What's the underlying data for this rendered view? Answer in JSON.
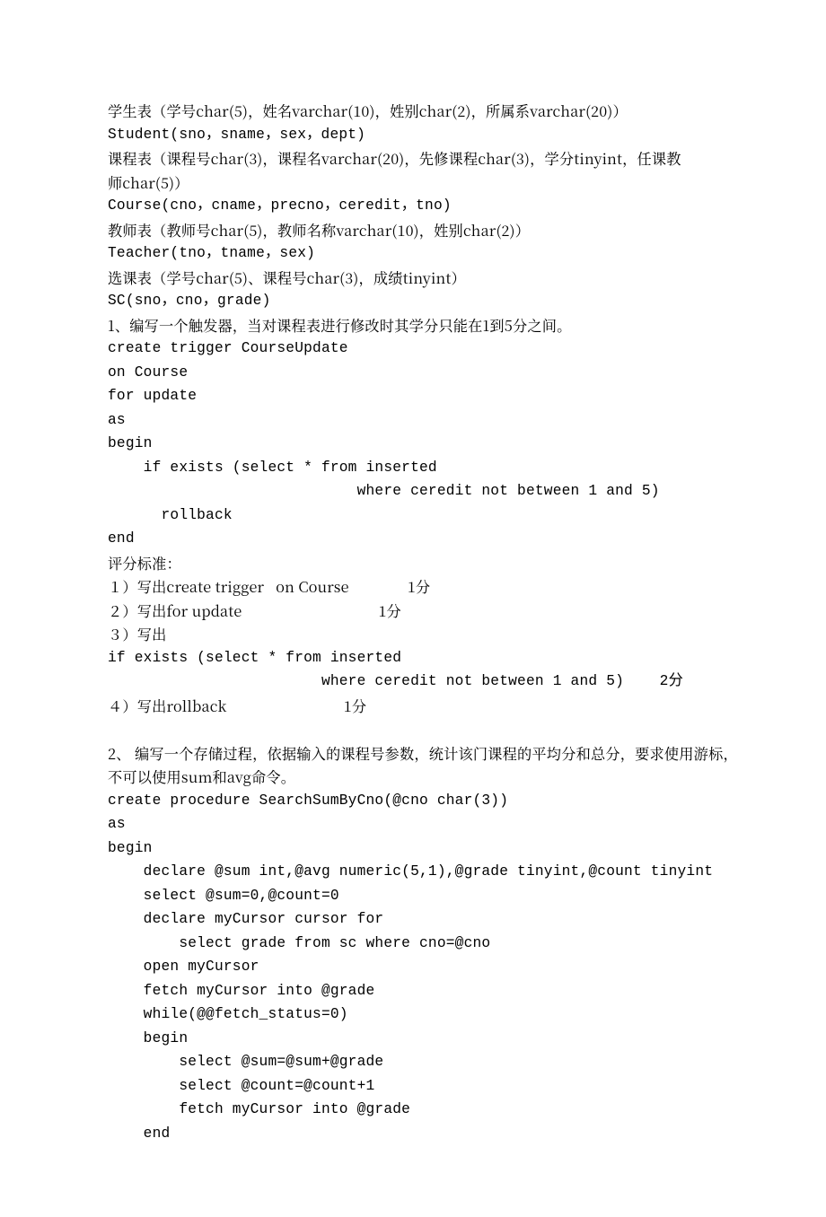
{
  "lines": [
    {
      "cls": "line",
      "text": "学生表（学号char(5)，姓名varchar(10)，姓别char(2)，所属系varchar(20)）"
    },
    {
      "cls": "line mono",
      "text": "Student(sno，sname，sex，dept)"
    },
    {
      "cls": "line",
      "text": "课程表（课程号char(3)，课程名varchar(20)，先修课程char(3)，学分tinyint，任课教"
    },
    {
      "cls": "line",
      "text": "师char(5)）"
    },
    {
      "cls": "line mono",
      "text": "Course(cno，cname，precno，ceredit，tno)"
    },
    {
      "cls": "line",
      "text": "教师表（教师号char(5)，教师名称varchar(10)，姓别char(2)）"
    },
    {
      "cls": "line mono",
      "text": "Teacher(tno，tname，sex)"
    },
    {
      "cls": "line",
      "text": "选课表（学号char(5)、课程号char(3)，成绩tinyint）"
    },
    {
      "cls": "line mono",
      "text": "SC(sno，cno，grade)"
    },
    {
      "cls": "line",
      "text": "1、编写一个触发器，当对课程表进行修改时其学分只能在1到5分之间。"
    },
    {
      "cls": "line mono",
      "text": "create trigger CourseUpdate"
    },
    {
      "cls": "line mono",
      "text": "on Course"
    },
    {
      "cls": "line mono",
      "text": "for update"
    },
    {
      "cls": "line mono",
      "text": "as"
    },
    {
      "cls": "line mono",
      "text": "begin"
    },
    {
      "cls": "line mono",
      "text": "    if exists (select * from inserted"
    },
    {
      "cls": "line mono",
      "text": "                            where ceredit not between 1 and 5)"
    },
    {
      "cls": "line mono",
      "text": "      rollback"
    },
    {
      "cls": "line mono",
      "text": "end"
    },
    {
      "cls": "line",
      "text": "评分标准："
    },
    {
      "cls": "line",
      "text": "１）写出create trigger   on Course               1分"
    },
    {
      "cls": "line",
      "text": "２）写出for update                                   1分"
    },
    {
      "cls": "line",
      "text": "３）写出"
    },
    {
      "cls": "line mono",
      "text": "if exists (select * from inserted"
    },
    {
      "cls": "line mono",
      "text": "                        where ceredit not between 1 and 5)    2分"
    },
    {
      "cls": "line",
      "text": "４）写出rollback                              1分"
    },
    {
      "cls": "line",
      "text": " "
    },
    {
      "cls": "line",
      "text": "2、 编写一个存储过程，依据输入的课程号参数，统计该门课程的平均分和总分，要求使用游标，"
    },
    {
      "cls": "line",
      "text": "不可以使用sum和avg命令。"
    },
    {
      "cls": "line mono",
      "text": "create procedure SearchSumByCno(@cno char(3))"
    },
    {
      "cls": "line mono",
      "text": "as"
    },
    {
      "cls": "line mono",
      "text": "begin"
    },
    {
      "cls": "line mono",
      "text": "    declare @sum int,@avg numeric(5,1),@grade tinyint,@count tinyint"
    },
    {
      "cls": "line mono",
      "text": "    select @sum=0,@count=0"
    },
    {
      "cls": "line mono",
      "text": "    declare myCursor cursor for"
    },
    {
      "cls": "line mono",
      "text": "        select grade from sc where cno=@cno"
    },
    {
      "cls": "line mono",
      "text": "    open myCursor"
    },
    {
      "cls": "line mono",
      "text": "    fetch myCursor into @grade"
    },
    {
      "cls": "line mono",
      "text": "    while(@@fetch_status=0)"
    },
    {
      "cls": "line mono",
      "text": "    begin"
    },
    {
      "cls": "line mono",
      "text": "        select @sum=@sum+@grade"
    },
    {
      "cls": "line mono",
      "text": "        select @count=@count+1"
    },
    {
      "cls": "line mono",
      "text": "        fetch myCursor into @grade"
    },
    {
      "cls": "line mono",
      "text": "    end"
    }
  ]
}
